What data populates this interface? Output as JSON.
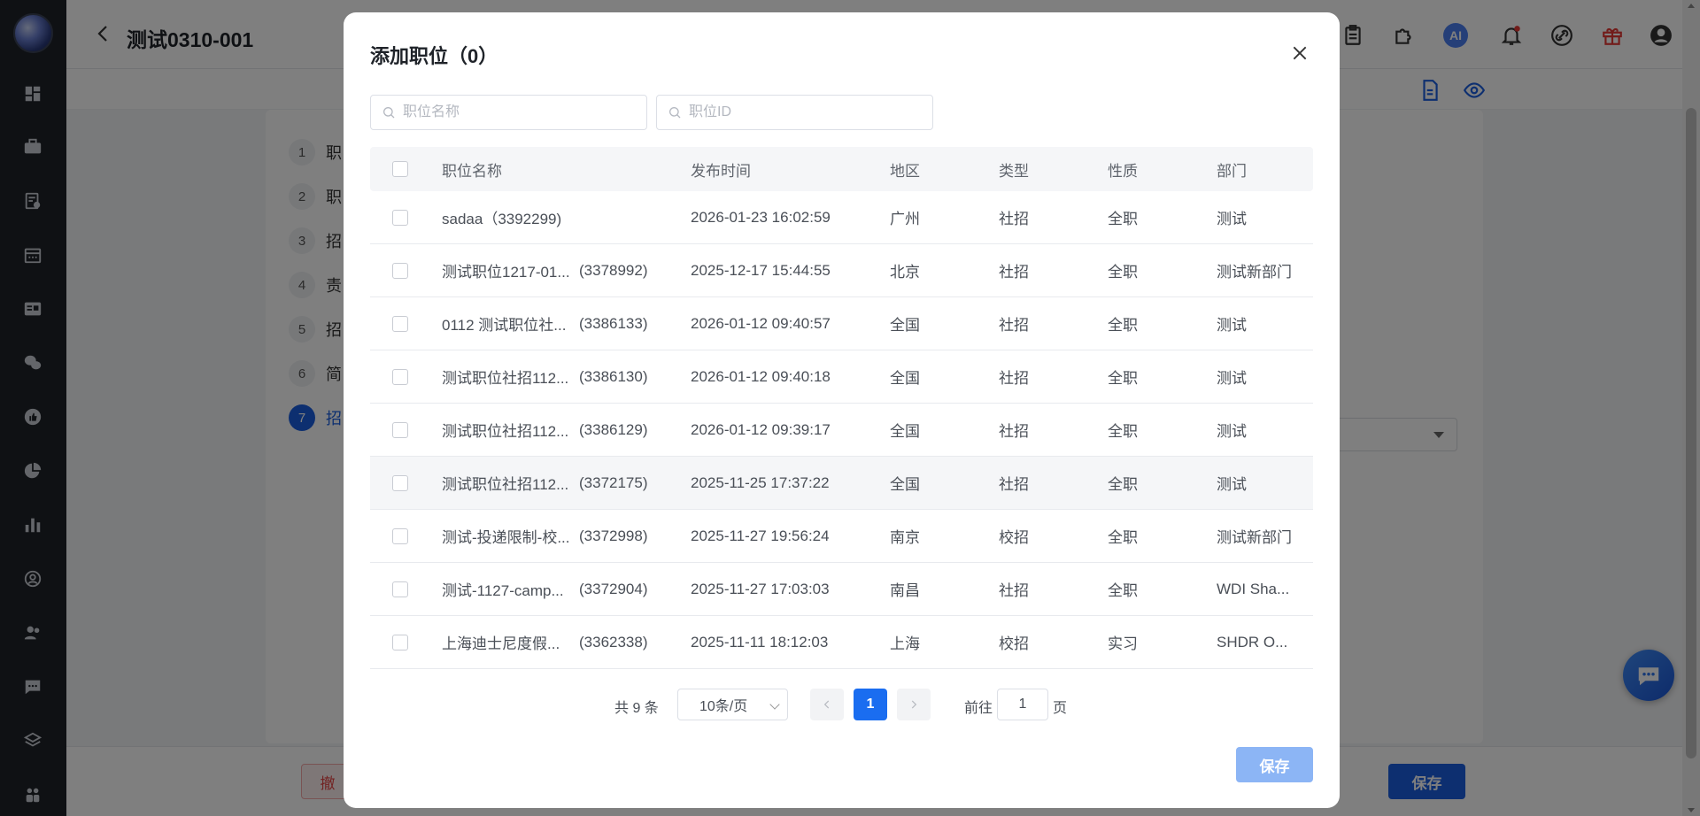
{
  "header": {
    "title": "测试0310-001",
    "icons": [
      "clipboard-icon",
      "puzzle-icon",
      "ai-icon",
      "bell-icon",
      "link-icon",
      "gift-icon",
      "account-icon"
    ],
    "ai_label": "AI"
  },
  "steps": [
    {
      "num": "1",
      "label": "职"
    },
    {
      "num": "2",
      "label": "职"
    },
    {
      "num": "3",
      "label": "招"
    },
    {
      "num": "4",
      "label": "责"
    },
    {
      "num": "5",
      "label": "招"
    },
    {
      "num": "6",
      "label": "简"
    },
    {
      "num": "7",
      "label": "招",
      "active": true
    }
  ],
  "footer": {
    "undo_label": "撤",
    "save_label": "保存"
  },
  "modal": {
    "title": "添加职位（0）",
    "search_name_placeholder": "职位名称",
    "search_id_placeholder": "职位ID",
    "columns": {
      "name": "职位名称",
      "date": "发布时间",
      "region": "地区",
      "type": "类型",
      "nature": "性质",
      "dept": "部门"
    },
    "rows": [
      {
        "name": "sadaa（3392299)",
        "id": "",
        "date": "2026-01-23 16:02:59",
        "region": "广州",
        "type": "社招",
        "nature": "全职",
        "dept": "测试"
      },
      {
        "name": "测试职位1217-01...",
        "id": "(3378992)",
        "date": "2025-12-17 15:44:55",
        "region": "北京",
        "type": "社招",
        "nature": "全职",
        "dept": "测试新部门"
      },
      {
        "name": "0112 测试职位社...",
        "id": "(3386133)",
        "date": "2026-01-12 09:40:57",
        "region": "全国",
        "type": "社招",
        "nature": "全职",
        "dept": "测试"
      },
      {
        "name": "测试职位社招112...",
        "id": "(3386130)",
        "date": "2026-01-12 09:40:18",
        "region": "全国",
        "type": "社招",
        "nature": "全职",
        "dept": "测试"
      },
      {
        "name": "测试职位社招112...",
        "id": "(3386129)",
        "date": "2026-01-12 09:39:17",
        "region": "全国",
        "type": "社招",
        "nature": "全职",
        "dept": "测试"
      },
      {
        "name": "测试职位社招112...",
        "id": "(3372175)",
        "date": "2025-11-25 17:37:22",
        "region": "全国",
        "type": "社招",
        "nature": "全职",
        "dept": "测试"
      },
      {
        "name": "测试-投递限制-校...",
        "id": "(3372998)",
        "date": "2025-11-27 19:56:24",
        "region": "南京",
        "type": "校招",
        "nature": "全职",
        "dept": "测试新部门"
      },
      {
        "name": "测试-1127-camp...",
        "id": "(3372904)",
        "date": "2025-11-27 17:03:03",
        "region": "南昌",
        "type": "社招",
        "nature": "全职",
        "dept": "WDI Sha..."
      },
      {
        "name": "上海迪士尼度假...",
        "id": "(3362338)",
        "date": "2025-11-11 18:12:03",
        "region": "上海",
        "type": "校招",
        "nature": "实习",
        "dept": "SHDR O..."
      }
    ],
    "pagination": {
      "total": "共 9 条",
      "page_size": "10条/页",
      "current": "1",
      "goto_label": "前往",
      "goto_value": "1",
      "goto_suffix": "页"
    },
    "save_label": "保存"
  },
  "colors": {
    "primary": "#1a6df0",
    "sidebar": "#1f2329",
    "disabled_primary": "#8cb5f5"
  }
}
